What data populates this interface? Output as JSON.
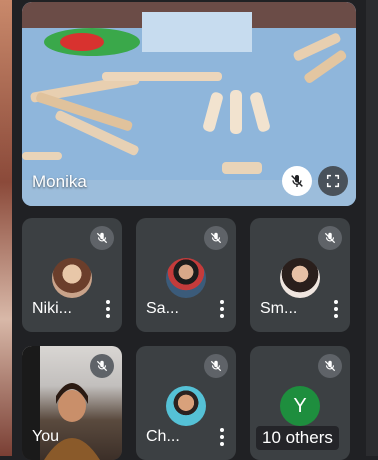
{
  "stage": {
    "name": "Monika"
  },
  "tiles": [
    {
      "name": "Niki...",
      "avatar": "photo-avatar"
    },
    {
      "name": "Sa...",
      "avatar": "photo-avatar"
    },
    {
      "name": "Sm...",
      "avatar": "photo-avatar"
    },
    {
      "name": "You",
      "avatar": "self-video"
    },
    {
      "name": "Ch...",
      "avatar": "photo-avatar"
    },
    {
      "name": "Y",
      "avatar": "letter-avatar",
      "initial": "Y"
    }
  ],
  "others_label": "10 others",
  "colors": {
    "background": "#202124",
    "tile": "#3c4043",
    "mic_badge": "#5f6368",
    "letter_avatar": "#1e8e3e"
  },
  "icons": [
    "mic-off-icon",
    "more-vert-icon",
    "fullscreen-icon"
  ]
}
